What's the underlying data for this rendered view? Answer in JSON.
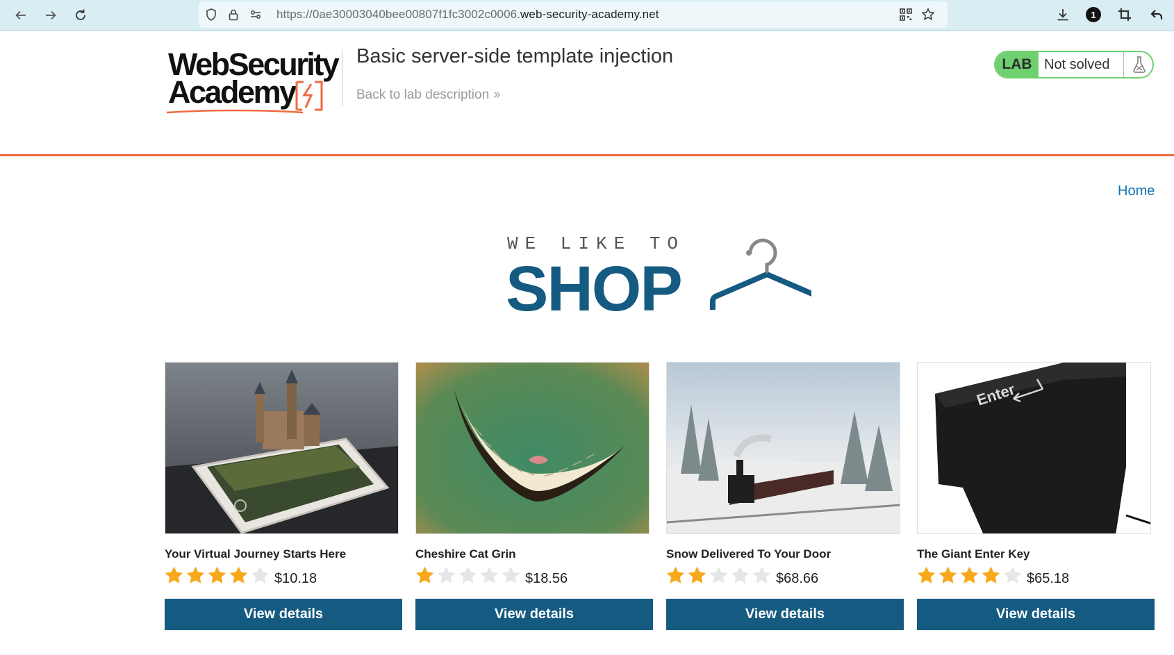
{
  "browser": {
    "url_prefix": "https://0ae30003040bee00807f1fc3002c0006.",
    "url_host": "web-security-academy.net",
    "extension_badge": "1"
  },
  "lab": {
    "logo_line1": "WebSecurity",
    "logo_line2": "Academy",
    "title": "Basic server-side template injection",
    "back_link": "Back to lab description",
    "badge_label": "LAB",
    "status": "Not solved",
    "status_color": "#6fd06f"
  },
  "nav": {
    "home": "Home"
  },
  "banner": {
    "tagline": "WE LIKE TO",
    "word": "SHOP"
  },
  "accent_colors": {
    "primary": "#155b81",
    "orange": "#ef6a3e",
    "link": "#0e74b4",
    "star": "#f7a81b"
  },
  "products": [
    {
      "name": "Your Virtual Journey Starts Here",
      "rating": 4,
      "price": "$10.18",
      "button": "View details",
      "image": "castle-phone-image"
    },
    {
      "name": "Cheshire Cat Grin",
      "rating": 1,
      "price": "$18.56",
      "button": "View details",
      "image": "grin-image"
    },
    {
      "name": "Snow Delivered To Your Door",
      "rating": 2,
      "price": "$68.66",
      "button": "View details",
      "image": "snow-train-image"
    },
    {
      "name": "The Giant Enter Key",
      "rating": 4,
      "price": "$65.18",
      "button": "View details",
      "image": "enter-key-image",
      "image_label": "Enter"
    }
  ]
}
